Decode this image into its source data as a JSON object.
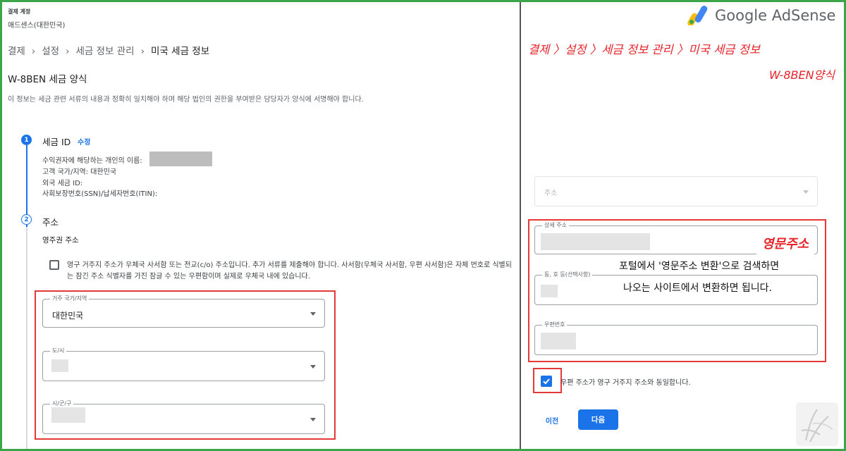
{
  "account": {
    "label": "결제 계정",
    "name": "애드센스(대한민국)"
  },
  "breadcrumb": {
    "items": [
      "결제",
      "설정",
      "세금 정보 관리",
      "미국 세금 정보"
    ]
  },
  "form": {
    "title": "W-8BEN 세금 양식",
    "description": "이 정보는 세금 관련 서류의 내용과 정확히 일치해야 하며 해당 법인의 권한을 부여받은 담당자가 양식에 서명해야 합니다."
  },
  "steps": {
    "one": {
      "number": "1",
      "title": "세금 ID",
      "edit": "수정"
    },
    "two": {
      "number": "2",
      "title": "주소"
    }
  },
  "tax_id": {
    "beneficiary": "수익권자에 해당하는 개인의 이름:",
    "country": "고객 국가/지역: 대한민국",
    "foreign_id": "외국 세금 ID:",
    "ssn": "사회보장번호(SSN)/납세자번호(ITIN):"
  },
  "address": {
    "permanent_label": "영주권 주소",
    "checkbox_text": "영구 거주지 주소가 우체국 사서함 또는 전교(c/o) 주소입니다. 추가 서류를 제출해야 합니다. 사서함(우체국 사서함, 우편 사서함)은 자체 번호로 식별되는 잠긴 주소 식별자를 가진 잠글 수 있는 우편함이며 실제로 우체국 내에 있습니다.",
    "country_field": {
      "label": "거주 국가/지역",
      "value": "대한민국"
    },
    "city_field": {
      "label": "도/시"
    },
    "district_field": {
      "label": "시/군/구"
    }
  },
  "right_panel": {
    "logo_text": "Google AdSense",
    "annotation_crumb": "결제 〉설정 〉세금 정보 관리 〉미국 세금 정보",
    "annotation_form": "W-8BEN양식",
    "state_field": {
      "placeholder": "주소"
    },
    "detail_field": {
      "label": "상세 주소"
    },
    "dong_field": {
      "label": "동, 호 등(선택사항)"
    },
    "postal_field": {
      "label": "우편번호"
    },
    "english_address_tag": "영문주소",
    "note_line1": "포털에서 '영문주소 변환'으로 검색하면",
    "note_line2": "나오는 사이트에서 변환하면 됩니다.",
    "same_address_text": "우편 주소가 영구 거주지 주소와 동일합니다.",
    "prev_button": "이전",
    "next_button": "다음",
    "same_address_checked": true
  },
  "colors": {
    "accent": "#1a73e8",
    "annotation": "#e53935",
    "border": "#3aa64a"
  }
}
